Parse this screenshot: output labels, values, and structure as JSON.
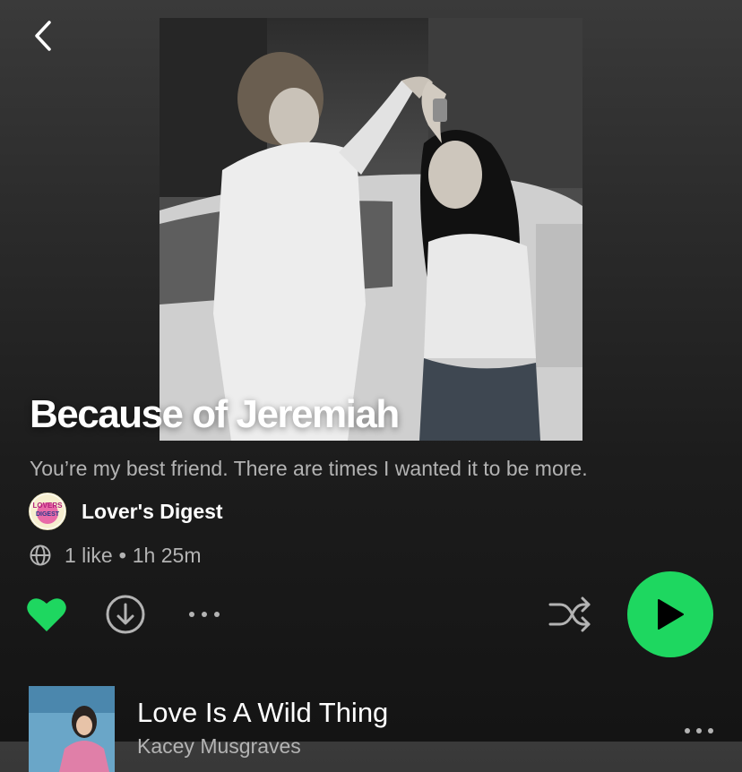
{
  "header": {
    "back_icon": "chevron-left-icon"
  },
  "playlist": {
    "title": "Because of Jeremiah",
    "description": "You’re my best friend. There are times I wanted it to be more.",
    "owner": {
      "name": "Lover's Digest",
      "avatar_text": "LOVERS DIGEST"
    },
    "meta": {
      "visibility_icon": "globe-icon",
      "likes": "1 like",
      "separator": "•",
      "duration": "1h 25m"
    }
  },
  "actions": {
    "like_icon": "heart-filled-icon",
    "download_icon": "download-circle-icon",
    "more_icon": "more-horizontal-icon",
    "shuffle_icon": "shuffle-icon",
    "play_icon": "play-icon",
    "liked": true
  },
  "tracks": [
    {
      "title": "Love Is A Wild Thing",
      "artist": "Kacey Musgraves"
    }
  ],
  "colors": {
    "accent": "#1ed760",
    "text_primary": "#ffffff",
    "text_secondary": "#b3b3b3"
  }
}
